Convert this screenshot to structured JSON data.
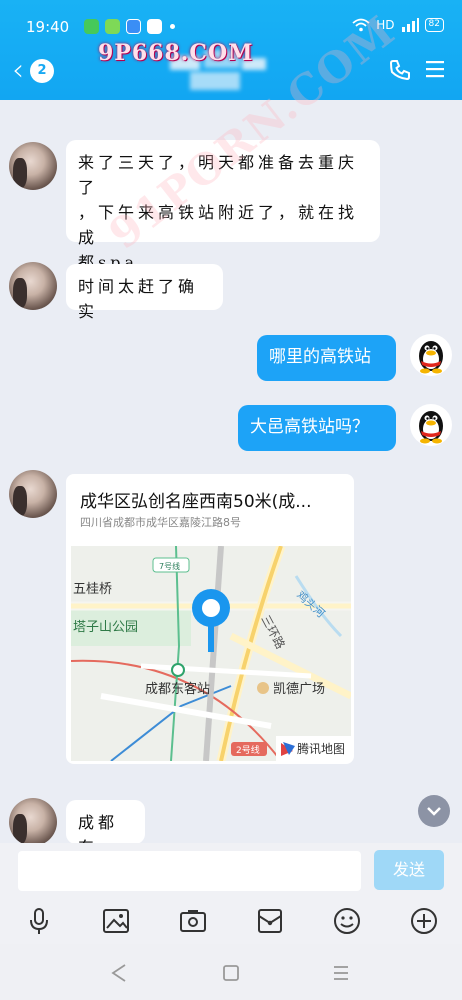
{
  "status_bar": {
    "time": "19:40",
    "network": "HD",
    "battery": "82"
  },
  "header": {
    "unread_count": "2"
  },
  "watermarks": {
    "top": "9P668.COM",
    "diagonal": "91PORN.COM"
  },
  "messages": [
    {
      "from": "contact",
      "text_lines": [
        "来了三天了，明天都准备去重庆了",
        "，下午来高铁站附近了，就在找成",
        "都spa"
      ]
    },
    {
      "from": "contact",
      "text": "时间太赶了确实"
    },
    {
      "from": "me",
      "text": "哪里的高铁站"
    },
    {
      "from": "me",
      "text": "大邑高铁站吗？"
    },
    {
      "from": "contact",
      "type": "location"
    },
    {
      "from": "contact",
      "text": "成都东"
    }
  ],
  "location_card": {
    "title": "成华区弘创名座西南50米(成...",
    "address": "四川省成都市成华区嘉陵江路8号",
    "map_labels": {
      "wuguiqiao": "五桂桥",
      "line7": "7号线",
      "tazishan": "塔子山公园",
      "sanhuan": "三环路",
      "jitouhe": "鸡头河",
      "station": "成都东客站",
      "plaza": "凯德广场",
      "line2": "2号线",
      "provider": "腾讯地图"
    }
  },
  "input": {
    "placeholder": "",
    "send_label": "发送"
  },
  "colors": {
    "header": "#12a6f2",
    "outgoing_bubble": "#1da3f7",
    "background": "#eaedf4",
    "send_button": "#9fd8f7"
  }
}
